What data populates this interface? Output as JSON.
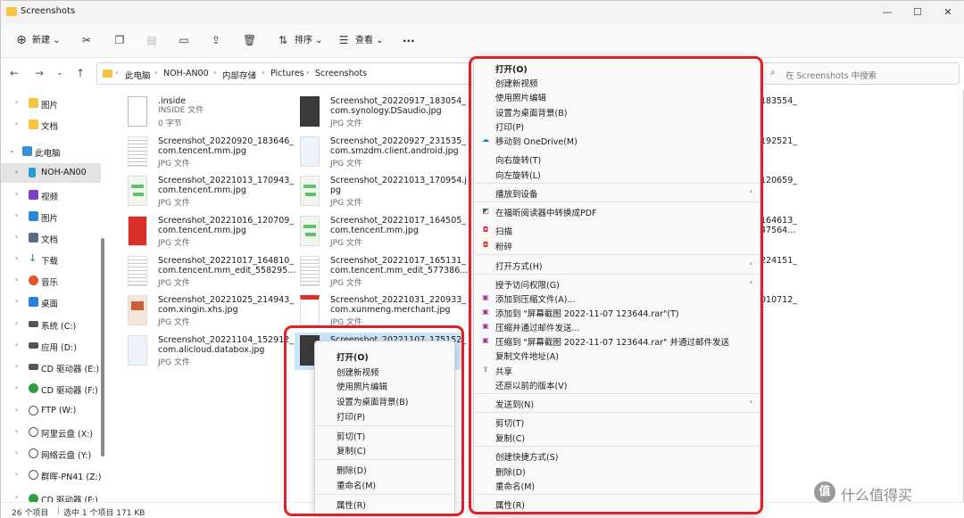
{
  "window": {
    "title": "Screenshots",
    "min_glyph": "—",
    "max_glyph": "☐",
    "close_glyph": "✕"
  },
  "toolbar": {
    "new_label": "新建",
    "sort_label": "排序",
    "view_label": "查看",
    "more_glyph": "···"
  },
  "nav": {
    "breadcrumb": [
      "此电脑",
      "NOH-AN00",
      "内部存储",
      "Pictures",
      "Screenshots"
    ],
    "search_placeholder": "在 Screenshots 中搜索"
  },
  "sidebar": {
    "items": [
      {
        "label": "图片",
        "icon": "folder-icon",
        "color": "#f6c343"
      },
      {
        "label": "文档",
        "icon": "folder-icon",
        "color": "#f6c343"
      },
      {
        "label": "此电脑",
        "icon": "computer-icon",
        "color": "#3a8fd6"
      },
      {
        "label": "NOH-AN00",
        "icon": "phone-icon",
        "color": "#2a9fd6"
      },
      {
        "label": "视频",
        "icon": "video-icon",
        "color": "#7b3fbf"
      },
      {
        "label": "图片",
        "icon": "picture-icon",
        "color": "#2b88d8"
      },
      {
        "label": "文档",
        "icon": "document-icon",
        "color": "#5a6d80"
      },
      {
        "label": "下载",
        "icon": "download-icon",
        "color": "#1b8e4f"
      },
      {
        "label": "音乐",
        "icon": "music-icon",
        "color": "#e2542a"
      },
      {
        "label": "桌面",
        "icon": "desktop-icon",
        "color": "#2a7fd6"
      },
      {
        "label": "系统 (C:)",
        "icon": "drive-icon",
        "color": "#555555"
      },
      {
        "label": "应用 (D:)",
        "icon": "drive-icon",
        "color": "#555555"
      },
      {
        "label": "CD 驱动器 (E:)",
        "icon": "cd-icon",
        "color": "#555555"
      },
      {
        "label": "CD 驱动器 (F:)",
        "icon": "cd-green-icon",
        "color": "#2e9e40"
      },
      {
        "label": "FTP (W:)",
        "icon": "network-drive-icon",
        "color": "#555555"
      },
      {
        "label": "阿里云盘 (X:)",
        "icon": "network-drive-icon",
        "color": "#555555"
      },
      {
        "label": "网络云盘 (Y:)",
        "icon": "network-drive-icon",
        "color": "#555555"
      },
      {
        "label": "群晖-PN41 (Z:)",
        "icon": "network-drive-icon",
        "color": "#555555"
      },
      {
        "label": "CD 驱动器 (F:) I",
        "icon": "cd-green-icon",
        "color": "#2e9e40"
      }
    ]
  },
  "files": [
    {
      "line1": ".inside",
      "line2": "",
      "type": "INSIDE 文件",
      "extra": "0 字节",
      "thumb": "doc"
    },
    {
      "line1": "Screenshot_20220917_183054_",
      "line2": "com.synology.DSaudio.jpg",
      "type": "JPG 文件",
      "extra": "",
      "thumb": "dark"
    },
    {
      "line1": "183554_",
      "line2": "",
      "type": "",
      "extra": "",
      "thumb": "none"
    },
    {
      "line1": "Screenshot_20220920_183646_",
      "line2": "com.tencent.mm.jpg",
      "type": "JPG 文件",
      "extra": "",
      "thumb": "lines"
    },
    {
      "line1": "Screenshot_20220927_231535_",
      "line2": "com.smzdm.client.android.jpg",
      "type": "JPG 文件",
      "extra": "",
      "thumb": "bluelite"
    },
    {
      "line1": "192521_",
      "line2": "",
      "type": "",
      "extra": "",
      "thumb": "none"
    },
    {
      "line1": "Screenshot_20221013_170943_",
      "line2": "com.tencent.mm.jpg",
      "type": "JPG 文件",
      "extra": "",
      "thumb": "green"
    },
    {
      "line1": "Screenshot_20221013_170954.j",
      "line2": "pg",
      "type": "JPG 文件",
      "extra": "",
      "thumb": "green"
    },
    {
      "line1": "120659_",
      "line2": "",
      "type": "",
      "extra": "",
      "thumb": "none"
    },
    {
      "line1": "Screenshot_20221016_120709_",
      "line2": "com.tencent.mm.jpg",
      "type": "JPG 文件",
      "extra": "",
      "thumb": "red"
    },
    {
      "line1": "Screenshot_20221017_164505_",
      "line2": "com.tencent.mm.jpg",
      "type": "JPG 文件",
      "extra": "",
      "thumb": "green"
    },
    {
      "line1": "164613_",
      "line2": "47564...",
      "type": "",
      "extra": "",
      "thumb": "none"
    },
    {
      "line1": "Screenshot_20221017_164810_",
      "line2": "com.tencent.mm_edit_558295...",
      "type": "JPG 文件",
      "extra": "",
      "thumb": "lines"
    },
    {
      "line1": "Screenshot_20221017_165131_",
      "line2": "com.tencent.mm_edit_577386...",
      "type": "JPG 文件",
      "extra": "",
      "thumb": "lines"
    },
    {
      "line1": "224151_",
      "line2": "",
      "type": "",
      "extra": "",
      "thumb": "none"
    },
    {
      "line1": "Screenshot_20221025_214943_",
      "line2": "com.xingin.xhs.jpg",
      "type": "JPG 文件",
      "extra": "",
      "thumb": "tan"
    },
    {
      "line1": "Screenshot_20221031_220933_",
      "line2": "com.xunmeng.merchant.jpg",
      "type": "JPG 文件",
      "extra": "",
      "thumb": "redtop"
    },
    {
      "line1": "010712_",
      "line2": "",
      "type": "",
      "extra": "",
      "thumb": "none"
    },
    {
      "line1": "Screenshot_20221104_152912_",
      "line2": "com.alicloud.databox.jpg",
      "type": "JPG 文件",
      "extra": "",
      "thumb": "bluelite"
    },
    {
      "line1": "Screenshot_20221107_175152_",
      "line2": "",
      "type": "",
      "extra": "",
      "thumb": "dark"
    }
  ],
  "small_menu": {
    "items": [
      {
        "label": "打开(O)",
        "bold": true
      },
      {
        "label": "创建新视频"
      },
      {
        "label": "使用照片编辑"
      },
      {
        "label": "设置为桌面背景(B)"
      },
      {
        "label": "打印(P)"
      },
      {
        "sep": true
      },
      {
        "label": "剪切(T)"
      },
      {
        "label": "复制(C)"
      },
      {
        "sep": true
      },
      {
        "label": "删除(D)"
      },
      {
        "label": "重命名(M)"
      },
      {
        "sep": true
      },
      {
        "label": "属性(R)"
      }
    ]
  },
  "big_menu": {
    "items": [
      {
        "label": "打开(O)",
        "bold": true
      },
      {
        "label": "创建新视频"
      },
      {
        "label": "使用照片编辑"
      },
      {
        "label": "设置为桌面背景(B)"
      },
      {
        "label": "打印(P)"
      },
      {
        "label": "移动到 OneDrive(M)",
        "icon": "onedrive-icon",
        "glyph": "☁",
        "color": "#1f6fd8"
      },
      {
        "label": "向右旋转(T)"
      },
      {
        "label": "向左旋转(L)"
      },
      {
        "sep": true
      },
      {
        "label": "播放到设备",
        "sub": true
      },
      {
        "sep": true
      },
      {
        "label": "在福昕阅读器中转换成PDF",
        "icon": "foxit-icon",
        "glyph": "◩",
        "color": "#555555"
      },
      {
        "label": "扫描",
        "icon": "mi-scan-icon",
        "glyph": "◘",
        "color": "#e03030"
      },
      {
        "label": "粉碎",
        "icon": "mi-shred-icon",
        "glyph": "◘",
        "color": "#e03030"
      },
      {
        "sep": true
      },
      {
        "label": "打开方式(H)",
        "sub": true
      },
      {
        "sep": true
      },
      {
        "label": "授予访问权限(G)",
        "sub": true
      },
      {
        "label": "添加到压缩文件(A)...",
        "icon": "winrar-icon",
        "glyph": "▣",
        "color": "#9b3a8f"
      },
      {
        "label": "添加到 \"屏幕截图 2022-11-07 123644.rar\"(T)",
        "icon": "winrar-icon",
        "glyph": "▣",
        "color": "#9b3a8f"
      },
      {
        "label": "压缩并通过邮件发送...",
        "icon": "winrar-icon",
        "glyph": "▣",
        "color": "#9b3a8f"
      },
      {
        "label": "压缩到 \"屏幕截图 2022-11-07 123644.rar\" 并通过邮件发送",
        "icon": "winrar-icon",
        "glyph": "▣",
        "color": "#9b3a8f"
      },
      {
        "label": "复制文件地址(A)"
      },
      {
        "label": "共享",
        "icon": "share-icon",
        "glyph": "⇪",
        "color": "#444444"
      },
      {
        "label": "还原以前的版本(V)"
      },
      {
        "sep": true
      },
      {
        "label": "发送到(N)",
        "sub": true
      },
      {
        "sep": true
      },
      {
        "label": "剪切(T)"
      },
      {
        "label": "复制(C)"
      },
      {
        "sep": true
      },
      {
        "label": "创建快捷方式(S)"
      },
      {
        "label": "删除(D)"
      },
      {
        "label": "重命名(M)"
      },
      {
        "sep": true
      },
      {
        "label": "属性(R)"
      }
    ]
  },
  "status": {
    "count": "26 个项目",
    "selection": "选中 1 个项目  171 KB"
  },
  "watermark": {
    "logo": "值",
    "text": "什么值得买"
  },
  "colors": {
    "highlight": "#e0202a",
    "selection": "#cce4f7",
    "folder": "#f6c343"
  }
}
